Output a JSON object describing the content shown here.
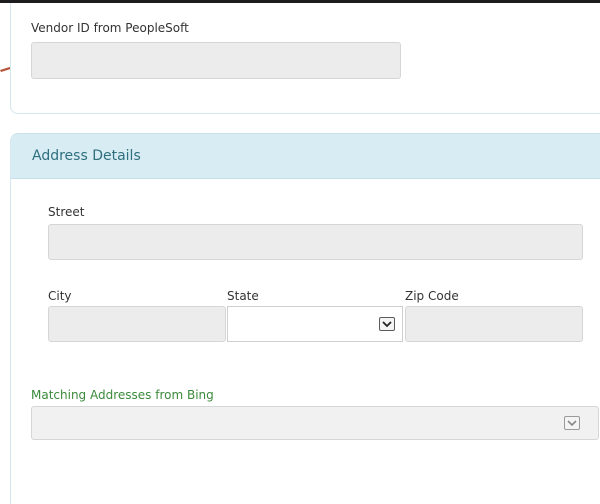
{
  "vendor": {
    "label": "Vendor ID from PeopleSoft",
    "value": ""
  },
  "address": {
    "title": "Address Details",
    "street": {
      "label": "Street",
      "value": ""
    },
    "city": {
      "label": "City",
      "value": ""
    },
    "state": {
      "label": "State",
      "value": ""
    },
    "zip": {
      "label": "Zip Code",
      "value": ""
    },
    "matching": {
      "label": "Matching Addresses from Bing",
      "value": ""
    }
  },
  "icons": {
    "arrow": "pointer-arrow-icon",
    "dropdown": "chevron-down-icon"
  },
  "colors": {
    "header_bg": "#d7ecf3",
    "title_text": "#2f6f7e",
    "field_bg": "#ececec",
    "matching_label": "#3b8a3b",
    "arrow": "#b5543a"
  }
}
